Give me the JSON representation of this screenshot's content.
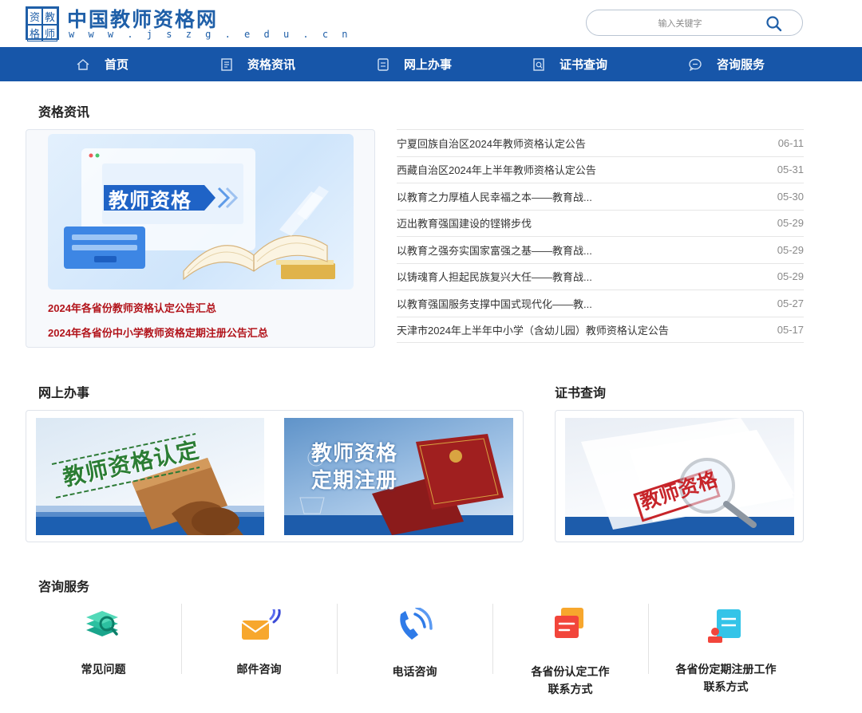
{
  "header": {
    "logo_seal_chars": [
      "资",
      "教",
      "格",
      "师"
    ],
    "site_title": "中国教师资格网",
    "site_url": "w w w . j s z g . e d u . c n",
    "search_placeholder": "输入关键字"
  },
  "nav": {
    "items": [
      {
        "label": "首页",
        "icon": "home-icon"
      },
      {
        "label": "资格资讯",
        "icon": "newspaper-icon"
      },
      {
        "label": "网上办事",
        "icon": "document-icon"
      },
      {
        "label": "证书查询",
        "icon": "search-document-icon"
      },
      {
        "label": "咨询服务",
        "icon": "chat-icon"
      }
    ]
  },
  "news_section": {
    "title": "资格资讯",
    "banner_text": "教师资格",
    "feature_links": [
      "2024年各省份教师资格认定公告汇总",
      "2024年各省份中小学教师资格定期注册公告汇总"
    ],
    "items": [
      {
        "title": "宁夏回族自治区2024年教师资格认定公告",
        "date": "06-11"
      },
      {
        "title": "西藏自治区2024年上半年教师资格认定公告",
        "date": "05-31"
      },
      {
        "title": "以教育之力厚植人民幸福之本——教育战...",
        "date": "05-30"
      },
      {
        "title": "迈出教育强国建设的铿锵步伐",
        "date": "05-29"
      },
      {
        "title": "以教育之强夯实国家富强之基——教育战...",
        "date": "05-29"
      },
      {
        "title": "以铸魂育人担起民族复兴大任——教育战...",
        "date": "05-29"
      },
      {
        "title": "以教育强国服务支撑中国式现代化——教...",
        "date": "05-27"
      },
      {
        "title": "天津市2024年上半年中小学（含幼儿园）教师资格认定公告",
        "date": "05-17"
      }
    ]
  },
  "online_section": {
    "title": "网上办事",
    "cards": [
      {
        "text": "教师资格认定"
      },
      {
        "text_line1": "教师资格",
        "text_line2": "定期注册"
      }
    ]
  },
  "cert_section": {
    "title": "证书查询",
    "card_text": "教师资格"
  },
  "consult_section": {
    "title": "咨询服务",
    "items": [
      {
        "label": "常见问题",
        "icon": "faq-books-icon"
      },
      {
        "label": "邮件咨询",
        "icon": "mail-icon"
      },
      {
        "label": "电话咨询",
        "icon": "phone-icon"
      },
      {
        "label_line1": "各省份认定工作",
        "label_line2": "联系方式",
        "icon": "contact-card-icon"
      },
      {
        "label_line1": "各省份定期注册工作",
        "label_line2": "联系方式",
        "icon": "registration-icon"
      }
    ]
  },
  "colors": {
    "brand_blue": "#1756a9",
    "accent_red": "#b2141b"
  }
}
